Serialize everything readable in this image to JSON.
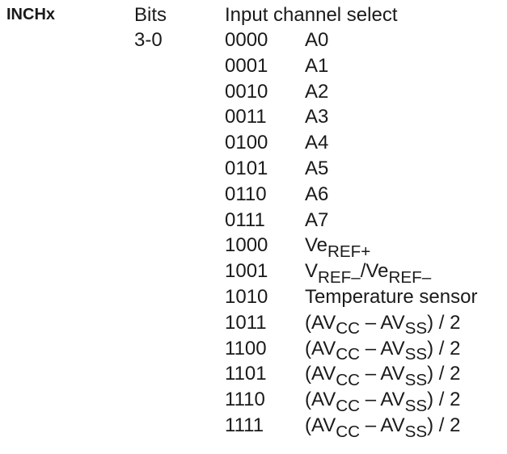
{
  "field": {
    "name": "INCHx",
    "bits_label": "Bits",
    "bits_range": "3-0",
    "description": "Input channel select"
  },
  "options": [
    {
      "code": "0000",
      "parts": [
        {
          "t": "A0"
        }
      ]
    },
    {
      "code": "0001",
      "parts": [
        {
          "t": "A1"
        }
      ]
    },
    {
      "code": "0010",
      "parts": [
        {
          "t": "A2"
        }
      ]
    },
    {
      "code": "0011",
      "parts": [
        {
          "t": "A3"
        }
      ]
    },
    {
      "code": "0100",
      "parts": [
        {
          "t": "A4"
        }
      ]
    },
    {
      "code": "0101",
      "parts": [
        {
          "t": "A5"
        }
      ]
    },
    {
      "code": "0110",
      "parts": [
        {
          "t": "A6"
        }
      ]
    },
    {
      "code": "0111",
      "parts": [
        {
          "t": "A7"
        }
      ]
    },
    {
      "code": "1000",
      "parts": [
        {
          "t": "Ve"
        },
        {
          "t": "REF+",
          "sub": true
        }
      ]
    },
    {
      "code": "1001",
      "parts": [
        {
          "t": "V"
        },
        {
          "t": "REF–",
          "sub": true
        },
        {
          "t": "/Ve"
        },
        {
          "t": "REF–",
          "sub": true
        }
      ]
    },
    {
      "code": "1010",
      "parts": [
        {
          "t": "Temperature sensor"
        }
      ]
    },
    {
      "code": "1011",
      "parts": [
        {
          "t": "(AV"
        },
        {
          "t": "CC",
          "sub": true
        },
        {
          "t": " – AV"
        },
        {
          "t": "SS",
          "sub": true
        },
        {
          "t": ") / 2"
        }
      ]
    },
    {
      "code": "1100",
      "parts": [
        {
          "t": "(AV"
        },
        {
          "t": "CC",
          "sub": true
        },
        {
          "t": " – AV"
        },
        {
          "t": "SS",
          "sub": true
        },
        {
          "t": ") / 2"
        }
      ]
    },
    {
      "code": "1101",
      "parts": [
        {
          "t": "(AV"
        },
        {
          "t": "CC",
          "sub": true
        },
        {
          "t": " – AV"
        },
        {
          "t": "SS",
          "sub": true
        },
        {
          "t": ") / 2"
        }
      ]
    },
    {
      "code": "1110",
      "parts": [
        {
          "t": "(AV"
        },
        {
          "t": "CC",
          "sub": true
        },
        {
          "t": " – AV"
        },
        {
          "t": "SS",
          "sub": true
        },
        {
          "t": ") / 2"
        }
      ]
    },
    {
      "code": "1111",
      "parts": [
        {
          "t": "(AV"
        },
        {
          "t": "CC",
          "sub": true
        },
        {
          "t": " – AV"
        },
        {
          "t": "SS",
          "sub": true
        },
        {
          "t": ") / 2"
        }
      ]
    }
  ]
}
